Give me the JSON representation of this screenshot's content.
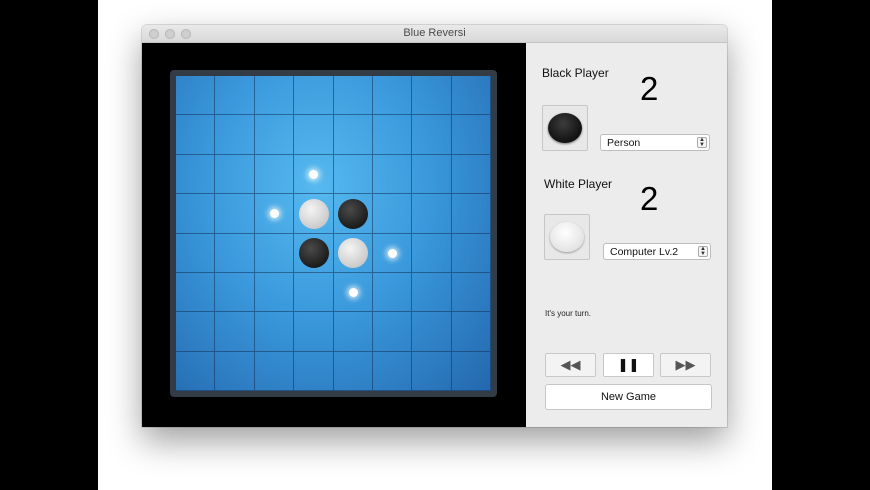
{
  "window": {
    "title": "Blue Reversi"
  },
  "black_player": {
    "label": "Black Player",
    "score": "2",
    "type": "Person"
  },
  "white_player": {
    "label": "White Player",
    "score": "2",
    "type": "Computer Lv.2"
  },
  "status": "It's your turn.",
  "controls": {
    "rewind_icon": "rewind-icon",
    "pause_icon": "pause-icon",
    "forward_icon": "fast-forward-icon"
  },
  "new_game_label": "New Game",
  "board": {
    "size": 8,
    "discs": [
      {
        "row": 3,
        "col": 3,
        "color": "white"
      },
      {
        "row": 3,
        "col": 4,
        "color": "black"
      },
      {
        "row": 4,
        "col": 3,
        "color": "black"
      },
      {
        "row": 4,
        "col": 4,
        "color": "white"
      }
    ],
    "hints": [
      {
        "row": 2,
        "col": 3
      },
      {
        "row": 3,
        "col": 2
      },
      {
        "row": 4,
        "col": 5
      },
      {
        "row": 5,
        "col": 4
      }
    ]
  }
}
